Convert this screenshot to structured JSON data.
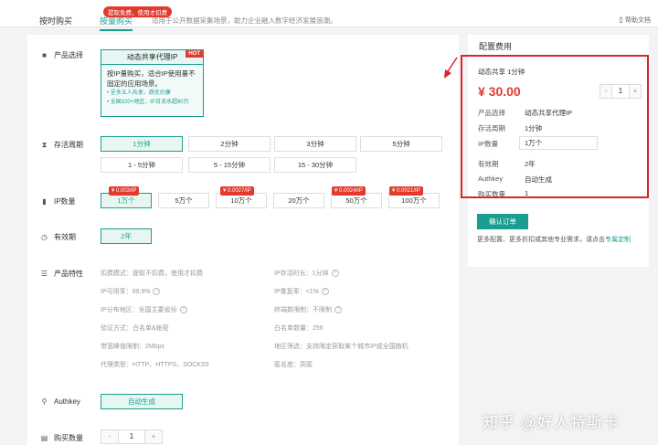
{
  "tabs": {
    "hourly": "按时购买",
    "volume": "按量购买"
  },
  "promo": "提取免费，使用才扣费",
  "tip": "适用于公开数据采集场景，助力企业融入数字经济发展浪潮。",
  "help": "帮助文档",
  "labels": {
    "product": "产品选择",
    "duration": "存活周期",
    "ip_count": "IP数量",
    "validity": "有效期",
    "features": "产品特性",
    "authkey": "Authkey",
    "buy_qty": "购买数量"
  },
  "product_card": {
    "title": "动态共享代理IP",
    "hot": "HOT",
    "desc": "按IP量购买，适合IP使用量不固定的应用场景。",
    "points": [
      "• 呈多五人共享，质优价廉",
      "• 全国100+地区，IP日流水超80万"
    ]
  },
  "durations": [
    "1分钟",
    "2分钟",
    "3分钟",
    "5分钟",
    "1 - 5分钟",
    "5 - 15分钟",
    "15 - 30分钟"
  ],
  "ip_counts": [
    "1万个",
    "5万个",
    "10万个",
    "20万个",
    "50万个",
    "100万个"
  ],
  "ip_badges": [
    "¥ 0.003/IP",
    "¥ 0.0027/IP",
    "¥ 0.0024/IP",
    "¥ 0.0021/IP"
  ],
  "validity_value": "2年",
  "features": [
    "扣费模式：提取不扣费，使用才扣费",
    "IP存活时长：1分钟",
    "IP可用率：99.9%",
    "IP重复率：<1%",
    "IP分布地区：全国主要省份",
    "终端数限制：不限制",
    "验证方式：白名单&帐密",
    "白名单数量：256",
    "带宽峰值限制：2Mbps",
    "地区筛选：支持限定获取某个城市IP或全国随机",
    "代理类型：HTTP、HTTPS、SOCKS5",
    "匿名度：高匿"
  ],
  "authkey_value": "自动生成",
  "qty": {
    "minus": "-",
    "value": "1",
    "plus": "+"
  },
  "side": {
    "title": "配置费用",
    "summary": "动态共享   1分钟",
    "price": "¥ 30.00",
    "stepper": {
      "minus": "-",
      "value": "1",
      "plus": "+"
    },
    "rows": [
      {
        "k": "产品选择",
        "v": "动态共享代理IP"
      },
      {
        "k": "存活周期",
        "v": "1分钟"
      },
      {
        "k": "IP数量",
        "v": "1万个"
      },
      {
        "k": "有效期",
        "v": "2年"
      },
      {
        "k": "Authkey",
        "v": "自动生成"
      },
      {
        "k": "购买数量",
        "v": "1"
      }
    ],
    "confirm": "确认订单",
    "more_text": "更多配置、更多折扣或其他专业需求，请点击",
    "more_link": "专属定制"
  },
  "watermark": "知乎 @好人特斯卡",
  "colors": {
    "accent": "#1a9e8f",
    "price": "#e23b2e",
    "highlight": "#d9262b"
  }
}
